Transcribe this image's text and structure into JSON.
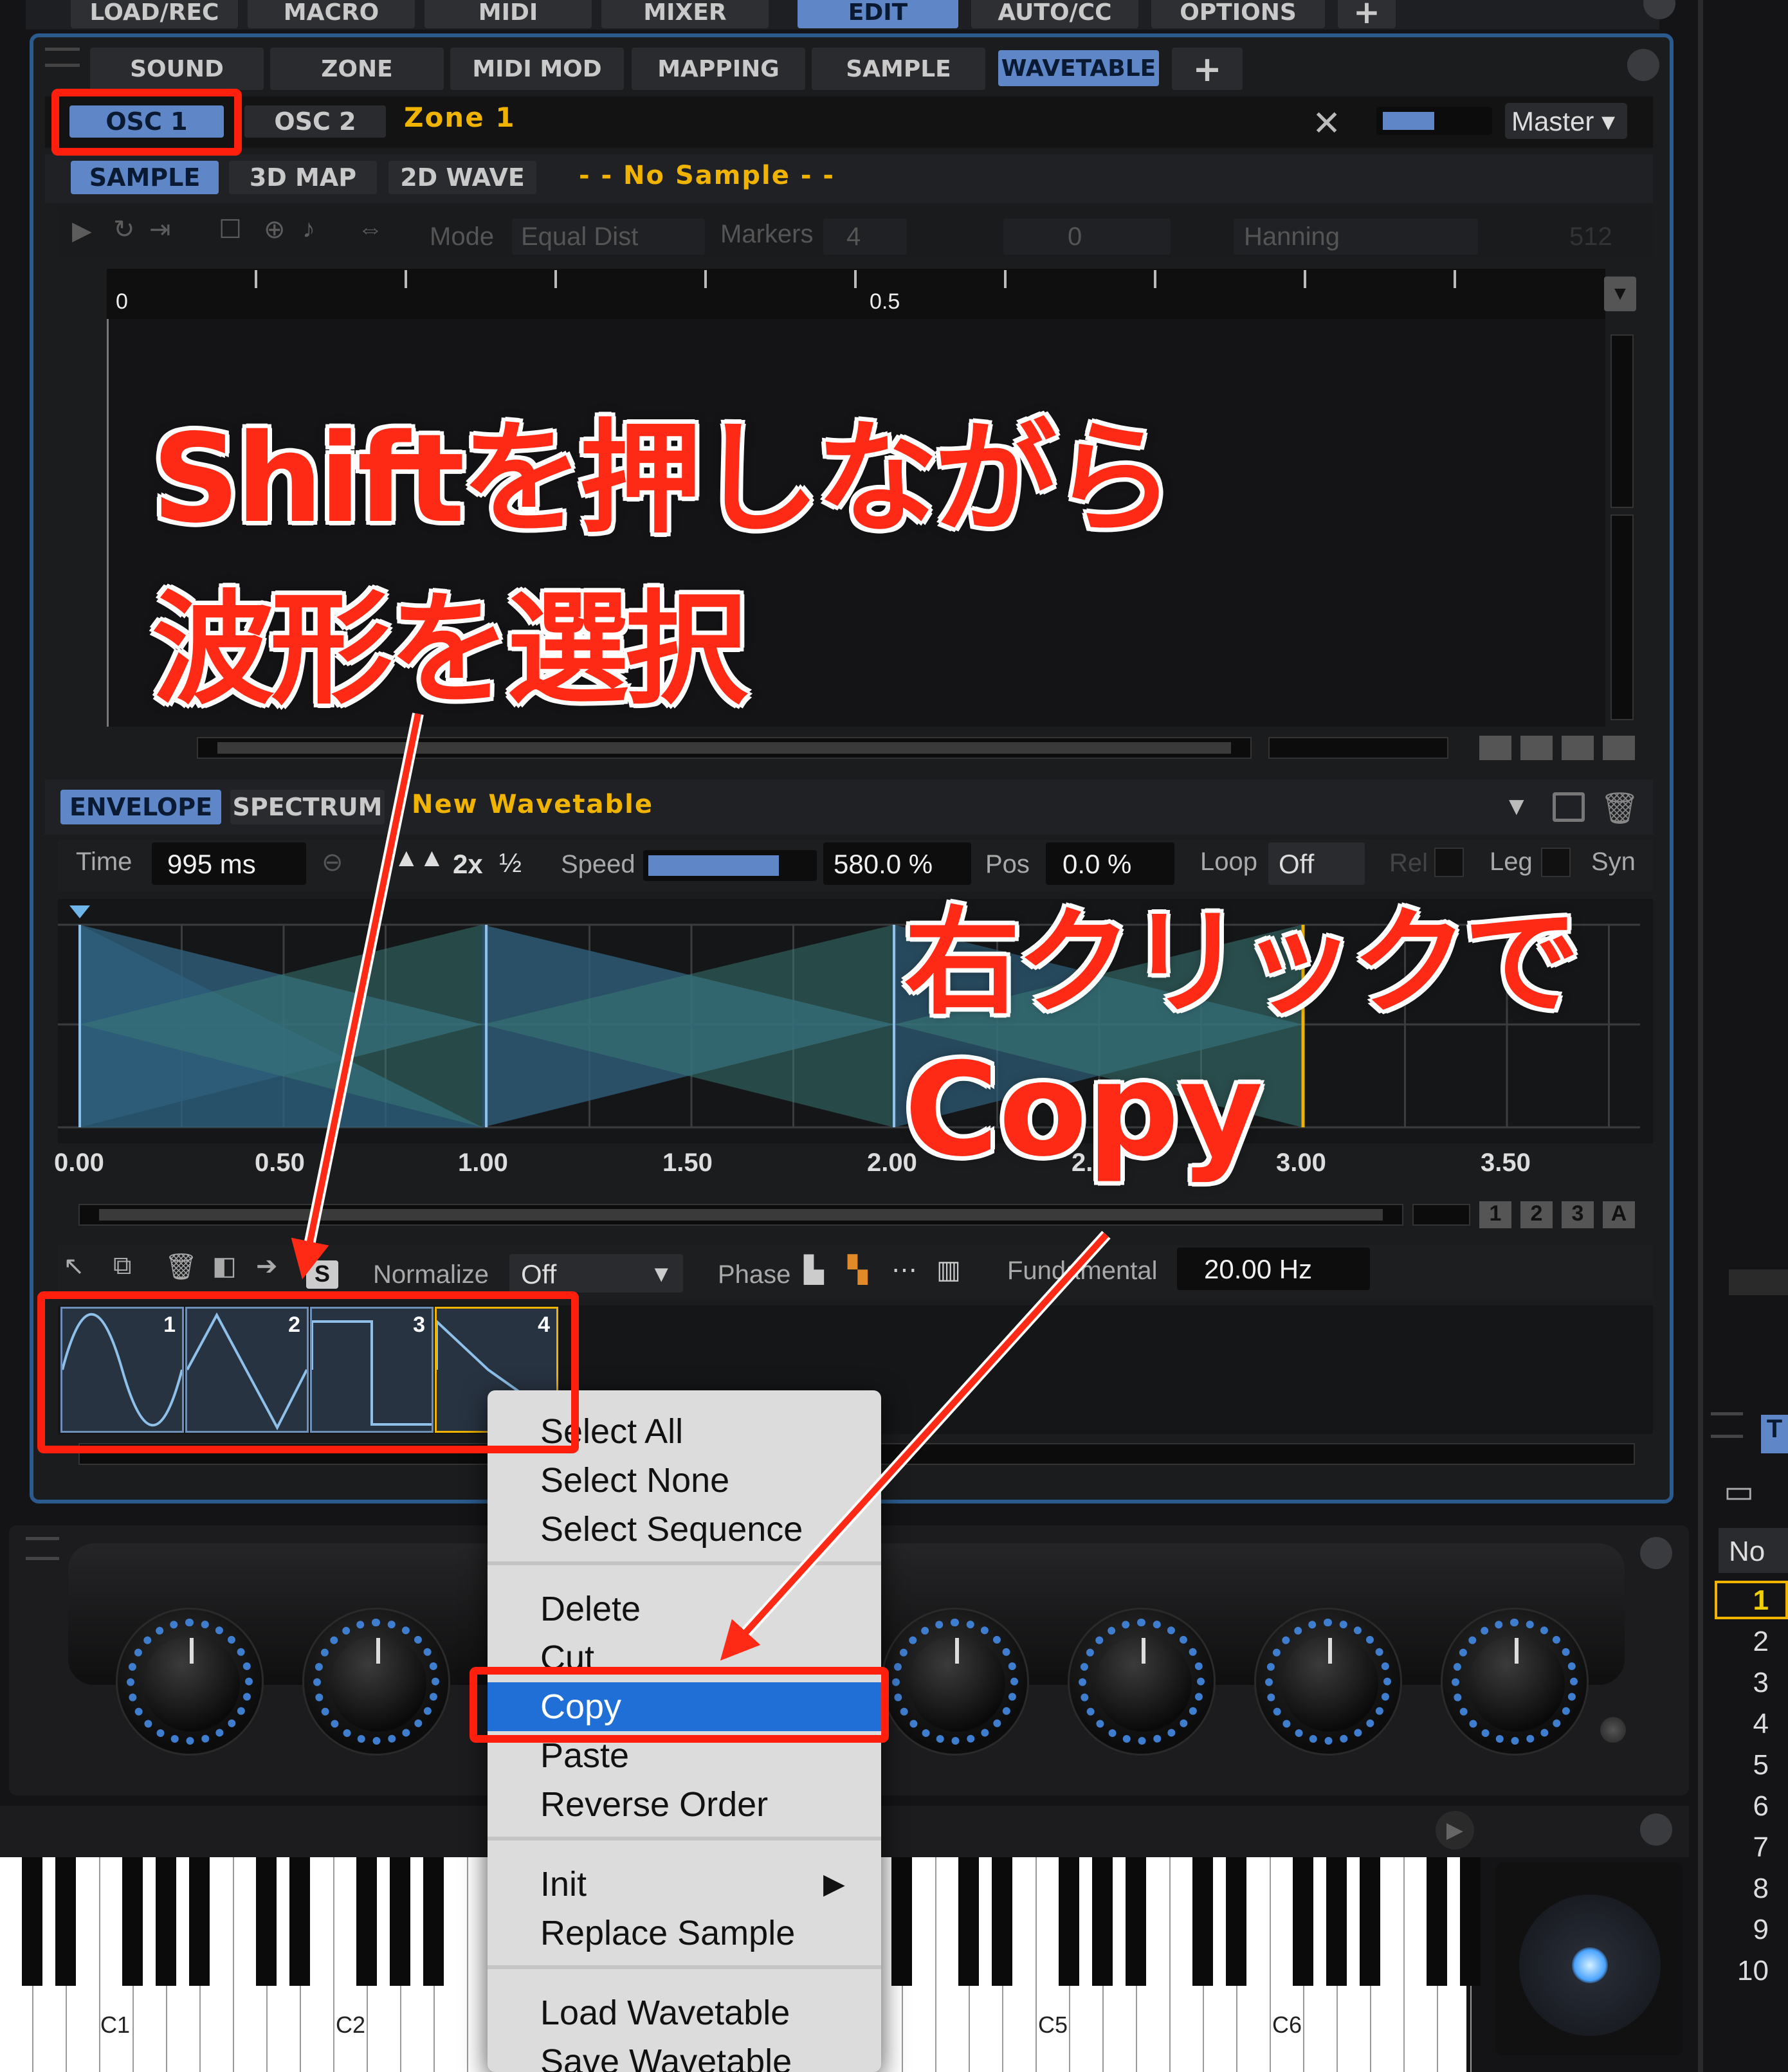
{
  "top_tabs": [
    "LOAD/REC",
    "MACRO",
    "MIDI",
    "MIXER",
    "EDIT",
    "AUTO/CC",
    "OPTIONS",
    "+"
  ],
  "active_top_tab": "EDIT",
  "sub_tabs": [
    "SOUND",
    "ZONE",
    "MIDI MOD",
    "MAPPING",
    "SAMPLE",
    "WAVETABLE",
    "+"
  ],
  "active_sub_tab": "WAVETABLE",
  "osc": {
    "osc1": "OSC 1",
    "osc2": "OSC 2",
    "zone": "Zone 1",
    "output": "Master"
  },
  "view_tabs": {
    "sample": "SAMPLE",
    "map3d": "3D MAP",
    "wave2d": "2D WAVE",
    "status": "- - No Sample - -"
  },
  "sample_toolbar": {
    "mode_label": "Mode",
    "mode_value": "Equal Dist",
    "markers_label": "Markers",
    "markers_value": "4",
    "offset_value": "0",
    "window_value": "Hanning",
    "size_value": "512"
  },
  "ruler": {
    "start": "0",
    "mid": "0.5"
  },
  "env_tabs": {
    "envelope": "ENVELOPE",
    "spectrum": "SPECTRUM",
    "name": "New Wavetable"
  },
  "env_controls": {
    "time_label": "Time",
    "time_value": "995 ms",
    "x2": "2x",
    "half": "½",
    "speed_label": "Speed",
    "speed_value": "580.0 %",
    "speed_fraction": 0.8,
    "pos_label": "Pos",
    "pos_value": "0.0 %",
    "loop_label": "Loop",
    "loop_value": "Off",
    "rel_label": "Rel",
    "leg_label": "Leg",
    "syn_label": "Syn"
  },
  "env_axis": [
    "0.00",
    "0.50",
    "1.00",
    "1.50",
    "2.00",
    "2.50",
    "3.00",
    "3.50"
  ],
  "wave_toolbar": {
    "normalize_label": "Normalize",
    "normalize_value": "Off",
    "phase_label": "Phase",
    "fundamental_label": "Fundamental",
    "fundamental_value": "20.00 Hz"
  },
  "scroll_buttons": [
    "1",
    "2",
    "3",
    "A"
  ],
  "wave_slots": [
    "1",
    "2",
    "3",
    "4"
  ],
  "context_menu": {
    "items": [
      "Select All",
      "Select None",
      "Select Sequence",
      "Delete",
      "Cut",
      "Copy",
      "Paste",
      "Reverse Order",
      "Init",
      "Replace Sample",
      "Load Wavetable",
      "Save Wavetable"
    ],
    "selected": "Copy",
    "submenu_arrow": "▶"
  },
  "keyboard_labels": [
    "C1",
    "C2",
    "C5",
    "C6"
  ],
  "right_panel": {
    "header": "No",
    "selected_row": "1",
    "rows": [
      "1",
      "2",
      "3",
      "4",
      "5",
      "6",
      "7",
      "8",
      "9",
      "10"
    ],
    "tab_letter": "T"
  },
  "annotations": {
    "line1": "Shiftを押しながら",
    "line2": "波形を選択",
    "line3": "右クリックで",
    "line4": "Copy"
  },
  "colors": {
    "accent_blue": "#5f86c6",
    "annotation_red": "#ff1f0c",
    "zone_orange": "#f0b400"
  }
}
